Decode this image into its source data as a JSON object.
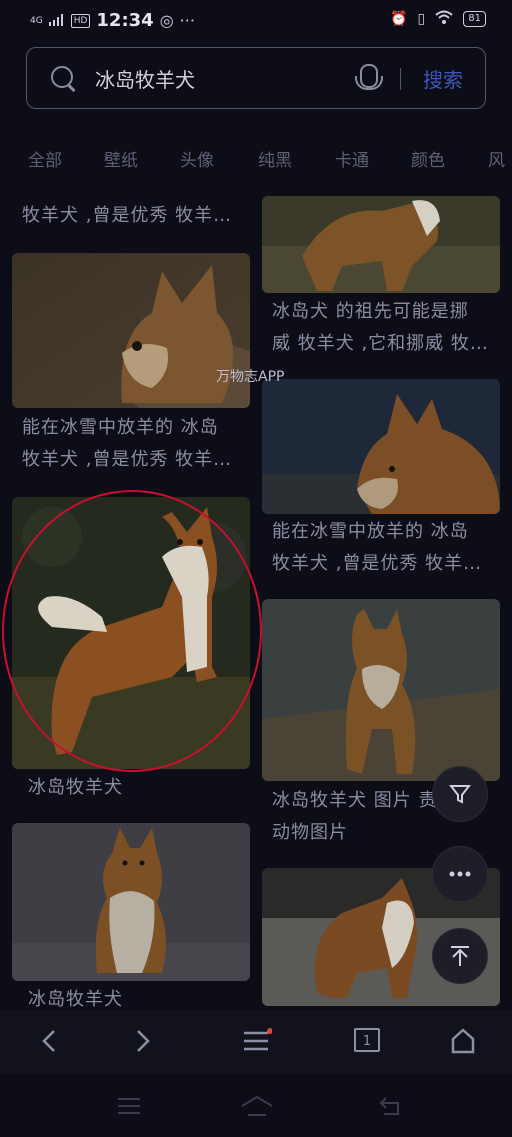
{
  "status_bar": {
    "signal": "4G",
    "hd": "HD",
    "time": "12:34",
    "battery": "81"
  },
  "search": {
    "query": "冰岛牧羊犬",
    "button": "搜索"
  },
  "tabs": [
    "全部",
    "壁纸",
    "头像",
    "纯黑",
    "卡通",
    "颜色",
    "风"
  ],
  "results_left": [
    {
      "caption_lines": [
        "牧羊犬 ,曾是优秀 牧羊…"
      ]
    },
    {
      "caption_lines": [
        "能在冰雪中放羊的 冰岛",
        "牧羊犬 ,曾是优秀 牧羊…"
      ]
    },
    {
      "caption_lines": [
        "冰岛牧羊犬"
      ]
    },
    {
      "caption_lines": [
        "冰岛牧羊犬"
      ]
    }
  ],
  "results_right": [
    {
      "caption_lines": [
        " 冰岛犬 的祖先可能是挪",
        "威 牧羊犬 ,它和挪威 牧…"
      ]
    },
    {
      "caption_lines": [
        "能在冰雪中放羊的 冰岛",
        "牧羊犬 ,曾是优秀 牧羊…"
      ]
    },
    {
      "caption_lines": [
        " 冰岛牧羊犬 图片 责",
        "动物图片"
      ]
    }
  ],
  "watermark": "万物志APP",
  "bottom_nav": {
    "tab_count": "1"
  },
  "icons": {
    "back": "back-icon",
    "forward": "forward-icon",
    "menu": "menu-icon",
    "tabs": "tabs-icon",
    "home": "home-icon",
    "filter": "filter-icon",
    "more": "more-icon",
    "top": "back-to-top-icon"
  },
  "colors": {
    "accent": "#3d57b8",
    "background": "#0d0d18",
    "highlight_circle": "#c8102e",
    "notification_dot": "#e0453a"
  }
}
